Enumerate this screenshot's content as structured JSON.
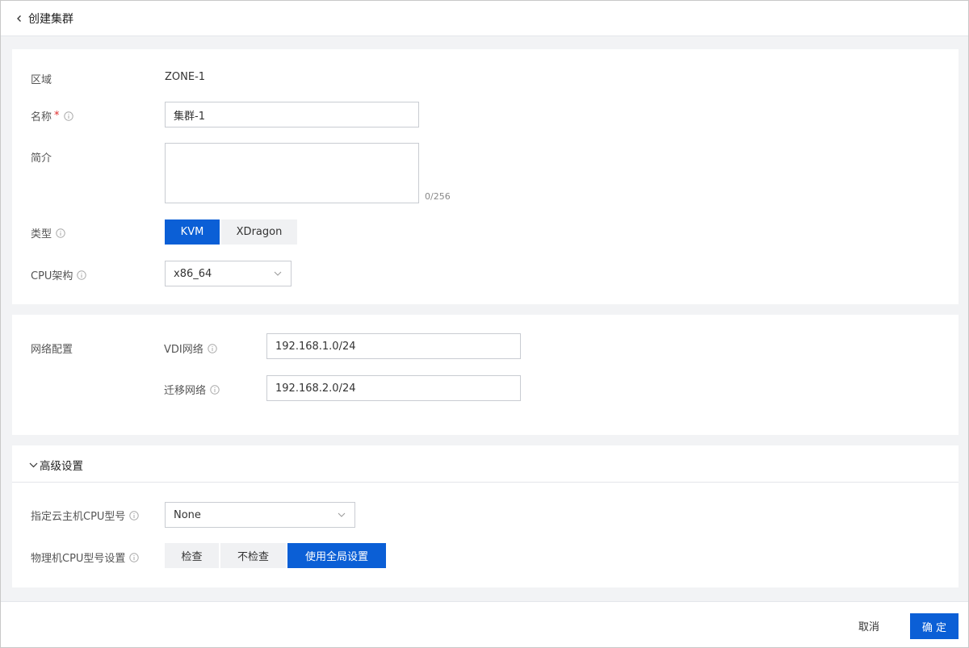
{
  "header": {
    "title": "创建集群"
  },
  "basic": {
    "zone_label": "区域",
    "zone_value": "ZONE-1",
    "name_label": "名称",
    "name_required": "*",
    "name_value": "集群-1",
    "desc_label": "简介",
    "desc_value": "",
    "desc_counter": "0/256",
    "type_label": "类型",
    "type_options": [
      "KVM",
      "XDragon"
    ],
    "type_selected": "KVM",
    "cpu_arch_label": "CPU架构",
    "cpu_arch_value": "x86_64"
  },
  "network": {
    "section_label": "网络配置",
    "vdi_label": "VDI网络",
    "vdi_value": "192.168.1.0/24",
    "migrate_label": "迁移网络",
    "migrate_value": "192.168.2.0/24"
  },
  "advanced": {
    "toggle_label": "高级设置",
    "vm_cpu_model_label": "指定云主机CPU型号",
    "vm_cpu_model_value": "None",
    "host_cpu_check_label": "物理机CPU型号设置",
    "host_cpu_check_options": [
      "检查",
      "不检查",
      "使用全局设置"
    ],
    "host_cpu_check_selected": "使用全局设置"
  },
  "footer": {
    "cancel_label": "取消",
    "confirm_label": "确 定"
  },
  "colors": {
    "primary": "#0b5fd6",
    "required": "#e02e2e",
    "background": "#f2f3f5"
  },
  "icons": {
    "back": "chevron-left-icon",
    "info": "info-icon",
    "dropdown": "chevron-down-icon",
    "collapse": "chevron-down-icon"
  }
}
